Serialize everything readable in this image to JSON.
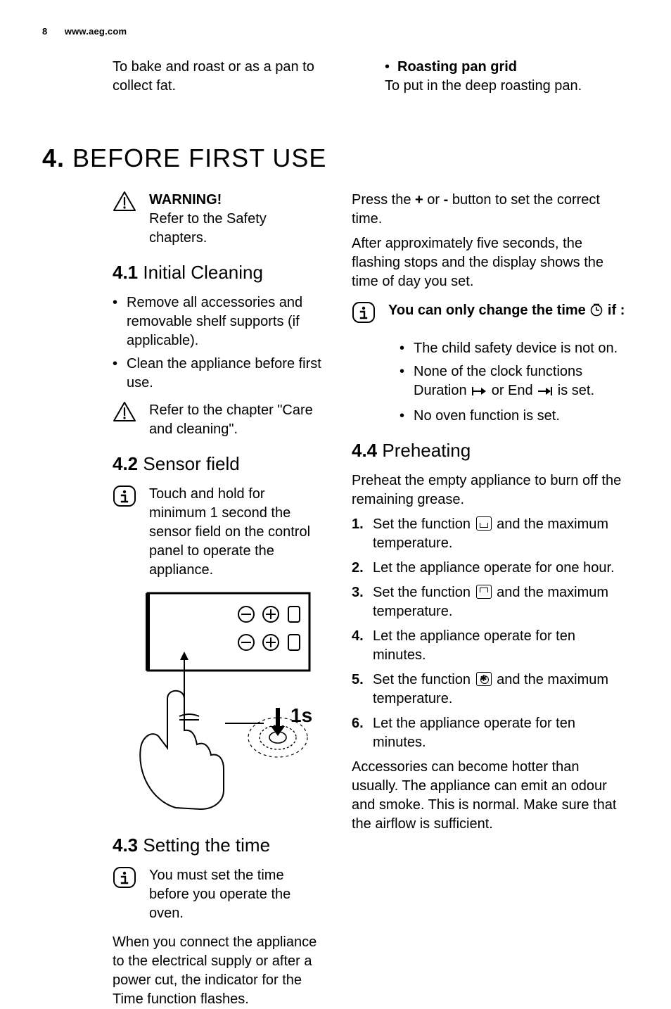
{
  "header": {
    "page": "8",
    "url": "www.aeg.com"
  },
  "top": {
    "line1": "To bake and roast or as a pan to collect fat.",
    "bullet": "Roasting pan grid",
    "line2": "To put in the deep roasting pan."
  },
  "section": {
    "num": "4.",
    "title": "BEFORE FIRST USE"
  },
  "warn1": {
    "title": "WARNING!",
    "text": "Refer to the Safety chapters."
  },
  "s41": {
    "num": "4.1",
    "title": "Initial Cleaning",
    "b1": "Remove all accessories and removable shelf supports (if applicable).",
    "b2": "Clean the appliance before first use.",
    "note": "Refer to the chapter \"Care and cleaning\"."
  },
  "s42": {
    "num": "4.2",
    "title": "Sensor field",
    "note": "Touch and hold for minimum 1 second the sensor field on the control panel to operate the appliance."
  },
  "s43": {
    "num": "4.3",
    "title": "Setting the time",
    "note": "You must set the time before you operate the oven.",
    "p1": "When you connect the appliance to the electrical supply or after a power cut, the indicator for the Time function flashes."
  },
  "right": {
    "p1a": "Press the ",
    "plus": "+",
    "p1b": " or ",
    "minus": "-",
    "p1c": " button to set the correct time.",
    "p2": "After approximately five seconds, the flashing stops and the display shows the time of day you set."
  },
  "info2": {
    "t1": "You can only change the time ",
    "t2": " if :",
    "b1": "The child safety device is not on.",
    "b2a": "None of the clock functions Duration ",
    "b2b": " or End ",
    "b2c": " is set.",
    "b3": "No oven function is set."
  },
  "s44": {
    "num": "4.4",
    "title": "Preheating",
    "intro": "Preheat the empty appliance to burn off the remaining grease.",
    "s1a": "Set the function ",
    "s1b": " and the maximum temperature.",
    "s2": "Let the appliance operate for one hour.",
    "s3a": "Set the function ",
    "s3b": " and the maximum temperature.",
    "s4": "Let the appliance operate for ten minutes.",
    "s5a": "Set the function ",
    "s5b": " and the maximum temperature.",
    "s6": "Let the appliance operate for ten minutes.",
    "outro": "Accessories can become hotter than usually. The appliance can emit an odour and smoke. This is normal. Make sure that the airflow is sufficient."
  },
  "figure_label": "1s"
}
